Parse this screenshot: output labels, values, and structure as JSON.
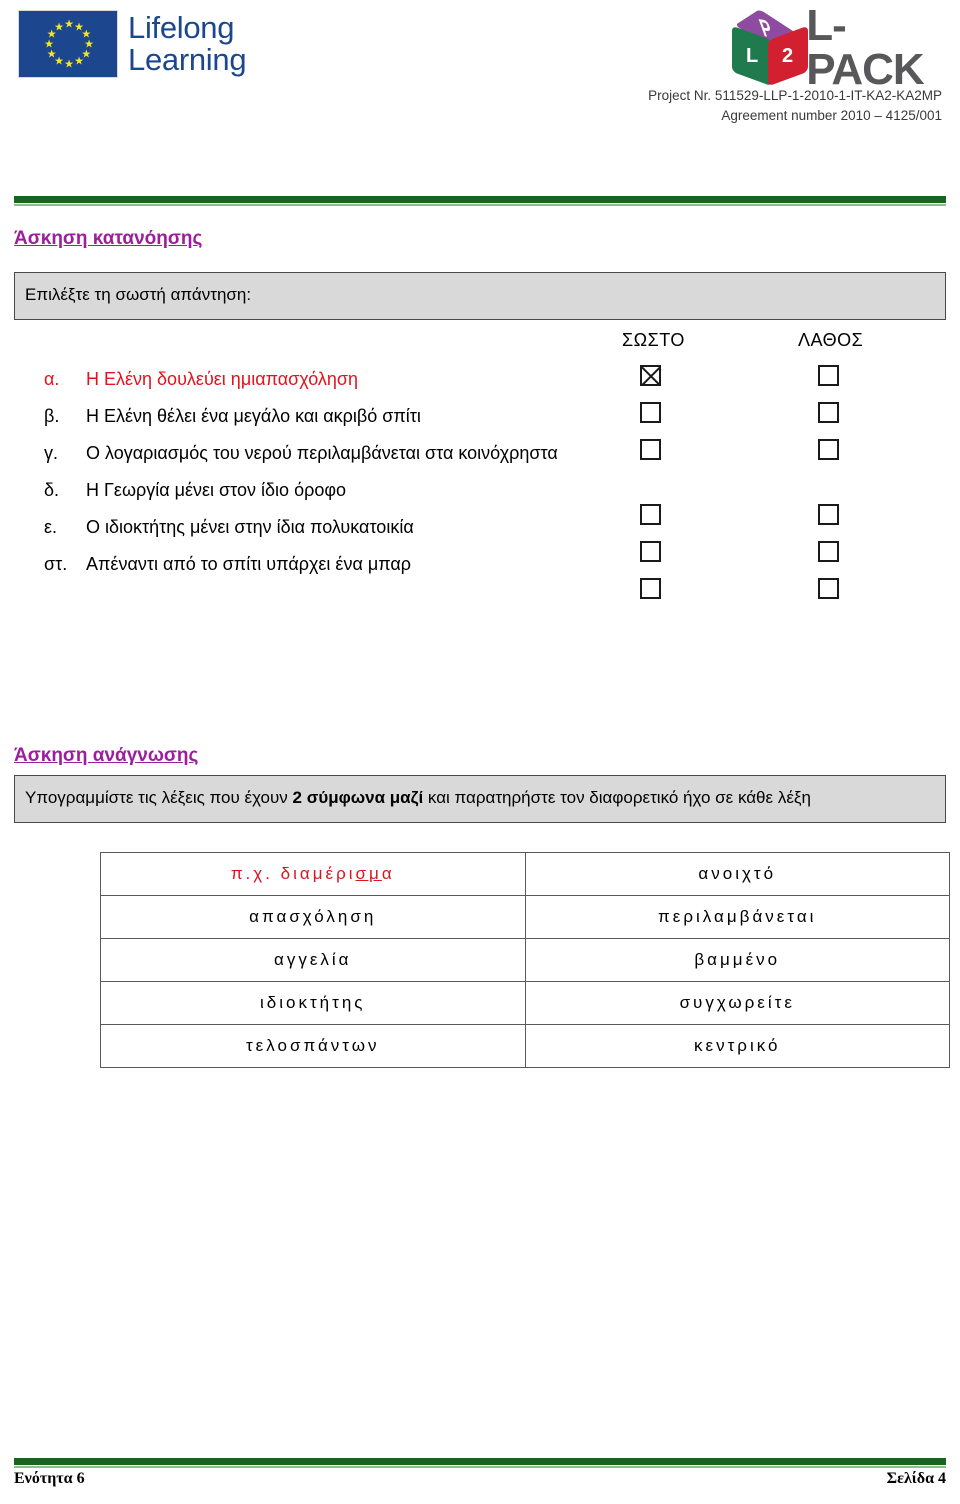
{
  "header": {
    "eu_logo": {
      "line1": "Lifelong",
      "line2": "Learning",
      "flag_color": "#1c478e",
      "star_color": "#f5e821"
    },
    "lpack_logo": {
      "cube_top_letter": "P",
      "cube_left_letter": "L",
      "cube_right_letter": "2",
      "wordmark": "L-PACK",
      "cube_top_color": "#8e4ca0",
      "cube_left_color": "#1f7a4d",
      "cube_right_color": "#d32030",
      "wordmark_color": "#58585a"
    },
    "project_line1": "Project Nr. 511529-LLP-1-2010-1-IT-KA2-KA2MP",
    "project_line2": "Agreement number 2010 – 4125/001"
  },
  "theme": {
    "rule_green": "#19651d",
    "rule_green_light": "#8cbf8e",
    "heading_purple": "#9c1e9c",
    "highlight_red": "#e3121b",
    "instruction_bg": "#d9d9d9"
  },
  "comprehension": {
    "title": "Άσκηση κατανόησης",
    "instruction": "Επιλέξτε τη σωστή απάντηση:",
    "column_true": "ΣΩΣΤΟ",
    "column_false": "ΛΑΘΟΣ",
    "items": [
      {
        "letter": "α.",
        "text": "Η Ελένη δουλεύει ημιαπασχόληση",
        "highlighted": true,
        "true_checked": true,
        "false_checked": false
      },
      {
        "letter": "β.",
        "text": "Η Ελένη θέλει ένα μεγάλο και ακριβό σπίτι",
        "highlighted": false,
        "true_checked": false,
        "false_checked": false
      },
      {
        "letter": "γ.",
        "text": "Ο λογαριασμός του νερού περιλαμβάνεται στα κοινόχρηστα",
        "highlighted": false,
        "true_checked": false,
        "false_checked": false
      },
      {
        "letter": "δ.",
        "text": "Η Γεωργία μένει στον ίδιο όροφο",
        "highlighted": false,
        "true_checked": false,
        "false_checked": false
      },
      {
        "letter": "ε.",
        "text": "Ο ιδιοκτήτης μένει στην ίδια πολυκατοικία",
        "highlighted": false,
        "true_checked": false,
        "false_checked": false
      },
      {
        "letter": "στ.",
        "text": "Απέναντι από το σπίτι υπάρχει ένα μπαρ",
        "highlighted": false,
        "true_checked": false,
        "false_checked": false
      }
    ]
  },
  "reading": {
    "title": "Άσκηση ανάγνωσης",
    "instruction_before": "Υπογραμμίστε τις λέξεις που έχουν ",
    "instruction_bold": "2 σύμφωνα μαζί",
    "instruction_after": " και παρατηρήστε τον διαφορετικό ήχο σε κάθε λέξη",
    "rows": [
      {
        "left_prefix": "π.χ. διαμέρι",
        "left_underlined": "σμ",
        "left_suffix": "α",
        "left_full": "π.χ. διαμέρισμα",
        "left_red": true,
        "right": "ανοιχτό"
      },
      {
        "left_full": "απασχόληση",
        "left_red": false,
        "right": "περιλαμβάνεται"
      },
      {
        "left_full": "αγγελία",
        "left_red": false,
        "right": "βαμμένο"
      },
      {
        "left_full": "ιδιοκτήτης",
        "left_red": false,
        "right": "συγχωρείτε"
      },
      {
        "left_full": "τελοσπάντων",
        "left_red": false,
        "right": "κεντρικό"
      }
    ]
  },
  "footer": {
    "left": "Ενότητα 6",
    "right": "Σελίδα 4"
  }
}
